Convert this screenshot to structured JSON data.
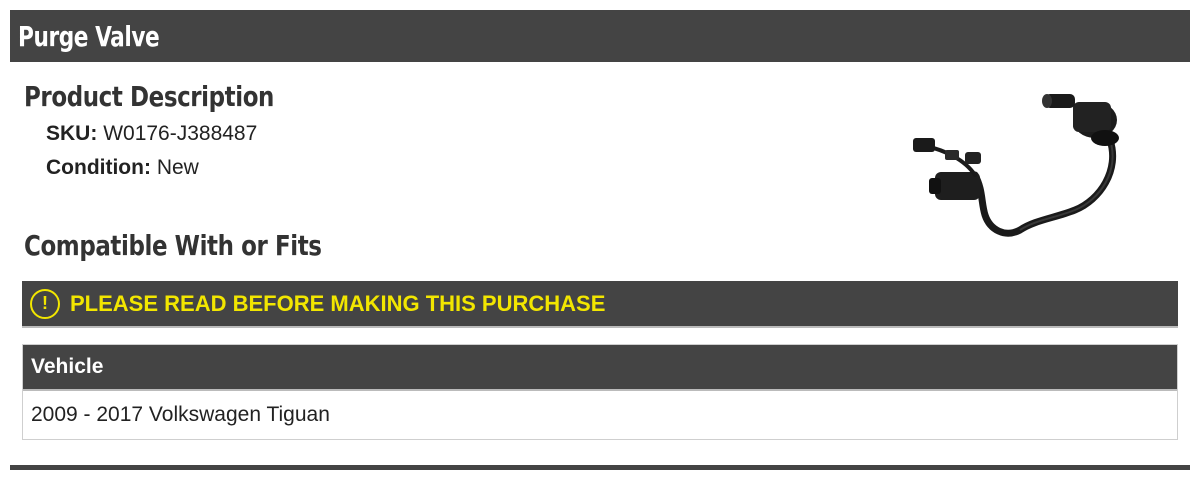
{
  "header": {
    "title": "Purge Valve"
  },
  "description": {
    "heading": "Product Description",
    "sku_label": "SKU:",
    "sku_value": "W0176-J388487",
    "condition_label": "Condition:",
    "condition_value": "New"
  },
  "fits": {
    "heading": "Compatible With or Fits",
    "warning_icon": "exclamation-circle-icon",
    "warning_text": "PLEASE READ BEFORE MAKING THIS PURCHASE",
    "table_header": "Vehicle",
    "rows": [
      "2009 - 2017 Volkswagen Tiguan"
    ]
  },
  "colors": {
    "bar_background": "#444444",
    "warning_accent": "#f2e600",
    "text": "#222222"
  }
}
